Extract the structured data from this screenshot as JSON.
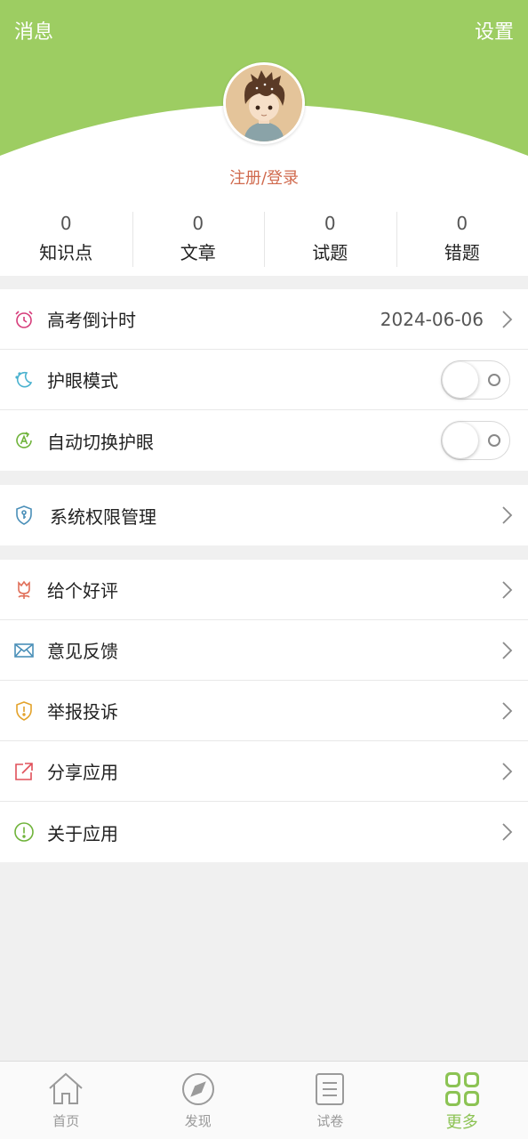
{
  "header": {
    "messages_label": "消息",
    "settings_label": "设置",
    "login_label": "注册/登录",
    "brand_color": "#9dcd62"
  },
  "stats": [
    {
      "value": "0",
      "label": "知识点"
    },
    {
      "value": "0",
      "label": "文章"
    },
    {
      "value": "0",
      "label": "试题"
    },
    {
      "value": "0",
      "label": "错题"
    }
  ],
  "section1": {
    "countdown": {
      "label": "高考倒计时",
      "value": "2024-06-06",
      "icon": "alarm-clock-icon"
    },
    "eye_mode": {
      "label": "护眼模式",
      "icon": "moon-icon",
      "enabled": false
    },
    "auto_eye": {
      "label": "自动切换护眼",
      "icon": "auto-a-icon",
      "enabled": false
    }
  },
  "section2": {
    "permissions": {
      "label": "系统权限管理",
      "icon": "shield-key-icon"
    }
  },
  "section3": {
    "items": [
      {
        "label": "给个好评",
        "icon": "flower-icon"
      },
      {
        "label": "意见反馈",
        "icon": "mail-icon"
      },
      {
        "label": "举报投诉",
        "icon": "warning-shield-icon"
      },
      {
        "label": "分享应用",
        "icon": "share-icon"
      },
      {
        "label": "关于应用",
        "icon": "info-circle-icon"
      }
    ]
  },
  "tabbar": {
    "tabs": [
      {
        "label": "首页",
        "icon": "home-icon"
      },
      {
        "label": "发现",
        "icon": "compass-icon"
      },
      {
        "label": "试卷",
        "icon": "paper-icon"
      },
      {
        "label": "更多",
        "icon": "grid-icon",
        "active": true
      }
    ],
    "active_color": "#8cc354"
  }
}
